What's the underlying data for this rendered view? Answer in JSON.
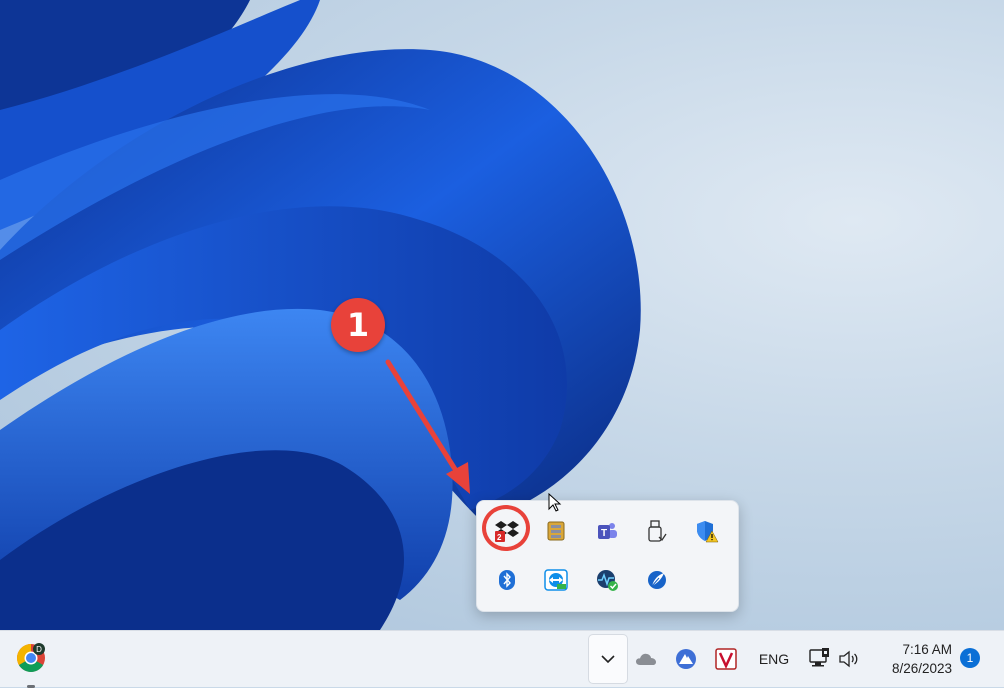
{
  "callout": {
    "number": "1"
  },
  "tray_flyout": {
    "icons": [
      {
        "name": "dropbox-icon",
        "badge": "2"
      },
      {
        "name": "archive-icon"
      },
      {
        "name": "teams-icon"
      },
      {
        "name": "usb-drive-icon"
      },
      {
        "name": "windows-security-icon"
      },
      {
        "name": "bluetooth-icon"
      },
      {
        "name": "teamviewer-icon"
      },
      {
        "name": "network-monitor-icon"
      },
      {
        "name": "app-feather-icon"
      }
    ]
  },
  "taskbar": {
    "language": "ENG",
    "time": "7:16 AM",
    "date": "8/26/2023",
    "notification_count": "1",
    "chrome_profile_letter": "D"
  }
}
